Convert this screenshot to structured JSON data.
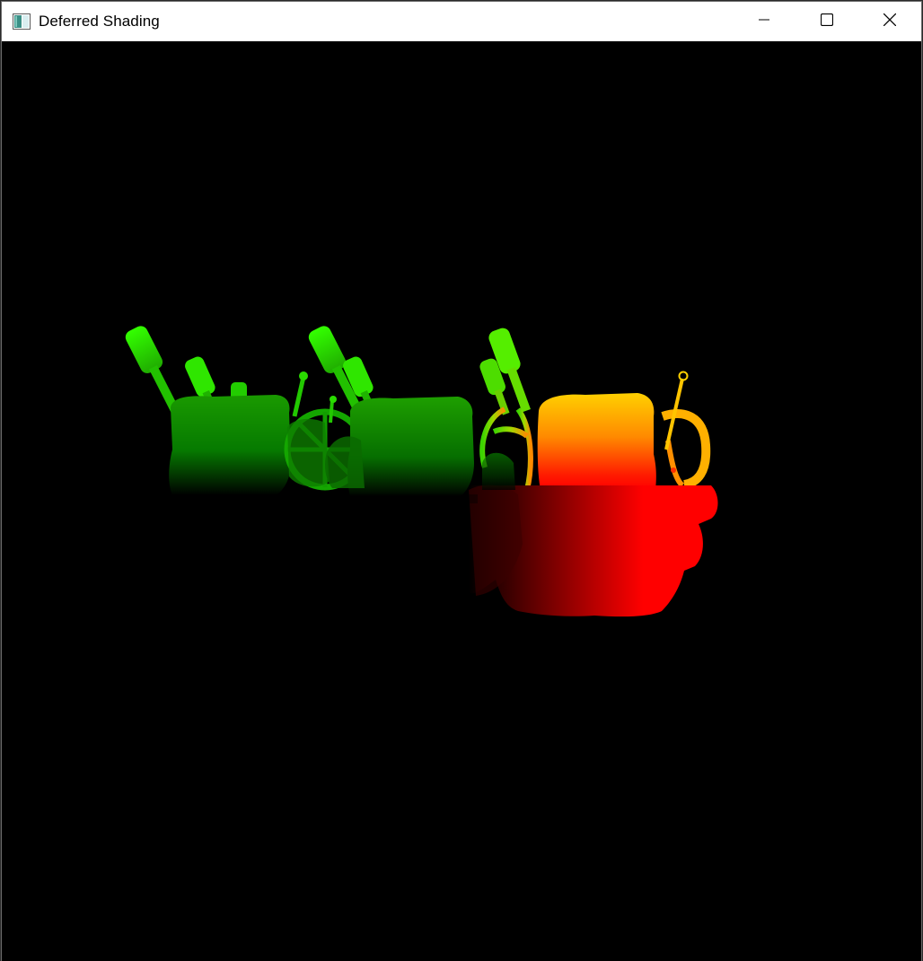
{
  "window": {
    "title": "Deferred Shading",
    "icon": "app-window-icon"
  },
  "controls": {
    "minimize_icon": "minimize-icon",
    "maximize_icon": "maximize-icon",
    "close_icon": "close-icon"
  },
  "viewport": {
    "background": "#000000",
    "render_pass_colors": {
      "green_dark": "#007a00",
      "green_bright": "#33ff00",
      "yellow": "#ffd200",
      "red": "#ff0000"
    }
  }
}
